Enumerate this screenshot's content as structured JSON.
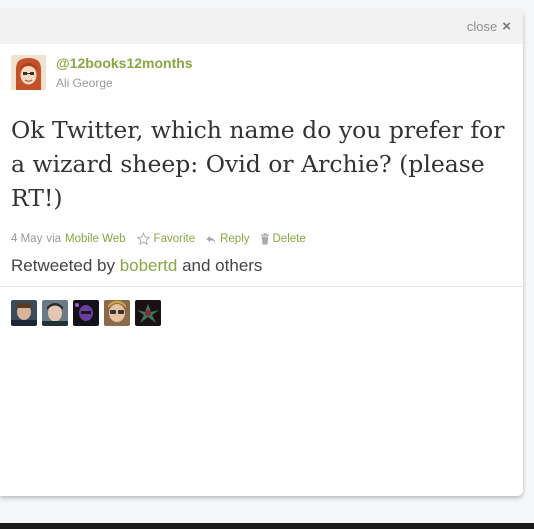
{
  "dialog": {
    "close_label": "close",
    "close_icon": "×"
  },
  "tweet": {
    "screen_name": "@12books12months",
    "real_name": "Ali George",
    "text": "Ok Twitter, which name do you prefer for a wizard sheep: Ovid or Archie? (please RT!)",
    "date": "4 May",
    "via_prefix": "via",
    "source": "Mobile Web",
    "actions": {
      "favorite": "Favorite",
      "reply": "Reply",
      "delete": "Delete"
    },
    "retweet": {
      "prefix": "Retweeted by",
      "user": "bobertd",
      "suffix": "and others"
    }
  },
  "colors": {
    "accent": "#8aa544",
    "text": "#333333",
    "muted": "#999999"
  },
  "icons": {
    "close": "close-icon",
    "favorite": "star-icon",
    "reply": "reply-arrow-icon",
    "delete": "trash-icon"
  }
}
